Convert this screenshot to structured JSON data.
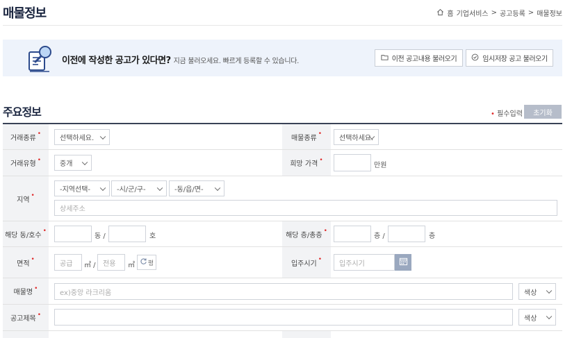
{
  "header": {
    "title": "매물정보",
    "breadcrumb": [
      "홈",
      "기업서비스",
      "공고등록",
      "매물정보"
    ]
  },
  "banner": {
    "strong": "이전에 작성한 공고가 있다면?",
    "sub": "지금 불러오세요. 빠르게 등록할 수 있습니다.",
    "btn_prev": "이전 공고내용 불러오기",
    "btn_temp": "임시저장 공고 불러오기"
  },
  "section": {
    "title": "주요정보",
    "required_note": "필수입력",
    "reset": "초기화"
  },
  "form": {
    "trade_kind": {
      "label": "거래종류",
      "value": "선택하세요."
    },
    "property_kind": {
      "label": "매물종류",
      "value": "선택하세요."
    },
    "trade_type": {
      "label": "거래유형",
      "value": "중개"
    },
    "hope_price": {
      "label": "희망 가격",
      "value": "",
      "unit": "만원"
    },
    "region": {
      "label": "지역",
      "sido": "-지역선택-",
      "sigungu": "-시/군/구-",
      "dong": "-동/읍/면-",
      "detail_placeholder": "상세주소"
    },
    "dong_ho": {
      "label": "해당 동/호수",
      "dong_unit": "동 /",
      "ho_unit": "호"
    },
    "floor": {
      "label": "해당 층/총층",
      "floor_unit": "층 /",
      "total_unit": "층"
    },
    "area": {
      "label": "면적",
      "supply_placeholder": "공급",
      "supply_unit": "㎡ /",
      "exclusive_placeholder": "전용",
      "exclusive_unit": "㎡",
      "convert": "평"
    },
    "move_in": {
      "label": "입주시기",
      "placeholder": "입주시기"
    },
    "property_name": {
      "label": "매물명",
      "placeholder": "ex)중앙 라크리움",
      "color_label": "색상"
    },
    "notice_title": {
      "label": "공고제목",
      "value": "",
      "color_label": "색상"
    }
  }
}
